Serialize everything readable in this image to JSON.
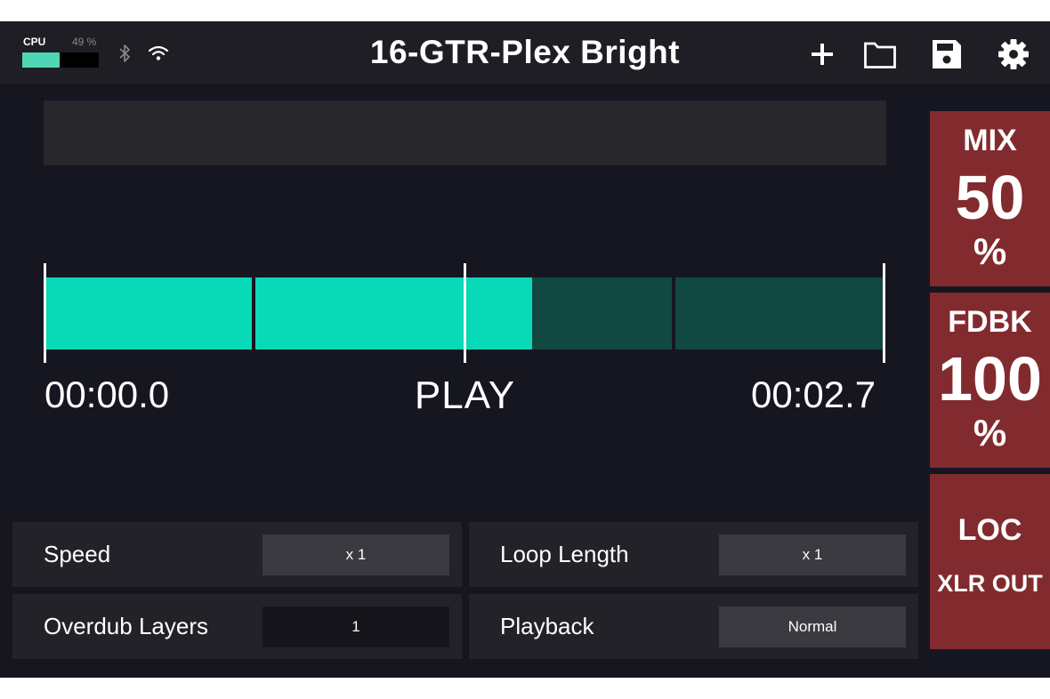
{
  "status": {
    "cpu_label": "CPU",
    "cpu_percent_text": "49 %",
    "cpu_fraction": 0.49,
    "bluetooth_icon": "bluetooth-icon",
    "wifi_icon": "wifi-icon"
  },
  "header": {
    "title": "16-GTR-Plex Bright",
    "icons": [
      "plus-icon",
      "folder-icon",
      "save-icon",
      "gear-icon"
    ]
  },
  "looper": {
    "start_time": "00:00.0",
    "end_time": "00:02.7",
    "state": "PLAY",
    "playhead_fraction": 0.58,
    "segments": 4
  },
  "params": {
    "speed": {
      "label": "Speed",
      "value": "x 1"
    },
    "loop_length": {
      "label": "Loop Length",
      "value": "x 1"
    },
    "overdub_layers": {
      "label": "Overdub Layers",
      "value": "1"
    },
    "playback": {
      "label": "Playback",
      "value": "Normal"
    }
  },
  "side": {
    "mix": {
      "label": "MIX",
      "value": "50",
      "unit": "%"
    },
    "fdbk": {
      "label": "FDBK",
      "value": "100",
      "unit": "%"
    },
    "loc": {
      "label": "LOC",
      "sub": "XLR OUT"
    }
  },
  "colors": {
    "accent": "#08d9b6",
    "accent_dim": "#124842",
    "side_button": "#822b2e",
    "background": "#151620"
  }
}
